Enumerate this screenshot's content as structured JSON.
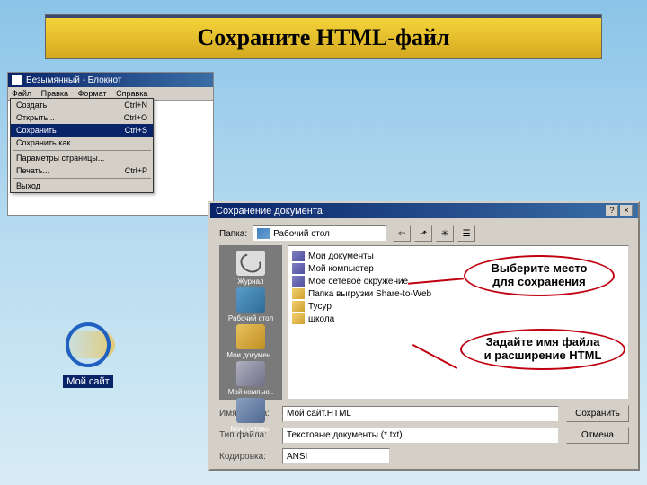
{
  "slide": {
    "title": "Сохраните HTML-файл"
  },
  "notepad": {
    "window_title": "Безымянный - Блокнот",
    "menu": {
      "file": "Файл",
      "edit": "Правка",
      "format": "Формат",
      "help": "Справка"
    },
    "items": [
      {
        "label": "Создать",
        "shortcut": "Ctrl+N"
      },
      {
        "label": "Открыть...",
        "shortcut": "Ctrl+O"
      },
      {
        "label": "Сохранить",
        "shortcut": "Ctrl+S",
        "selected": true
      },
      {
        "label": "Сохранить как...",
        "shortcut": ""
      },
      {
        "label": "Параметры страницы...",
        "shortcut": ""
      },
      {
        "label": "Печать...",
        "shortcut": "Ctrl+P"
      },
      {
        "label": "Выход",
        "shortcut": ""
      }
    ]
  },
  "ie": {
    "label": "Мой сайт"
  },
  "save_dialog": {
    "title": "Сохранение документа",
    "folder_label": "Папка:",
    "current_folder": "Рабочий стол",
    "sidebar": {
      "history": "Журнал",
      "desktop": "Рабочий стол",
      "mydocs": "Мои докумен..",
      "mycomp": "Мой компью..",
      "mynet": "Мое сетево."
    },
    "files": [
      "Мои документы",
      "Мой компьютер",
      "Мое сетевое окружение",
      "Папка выгрузки Share-to-Web",
      "Тусур",
      "школа"
    ],
    "filename_label": "Имя файла:",
    "filename_value": "Мой сайт.HTML",
    "type_label": "Тип файла:",
    "type_value": "Текстовые документы (*.txt)",
    "encoding_label": "Кодировка:",
    "encoding_value": "ANSI",
    "save_btn": "Сохранить",
    "cancel_btn": "Отмена"
  },
  "callouts": {
    "c1_l1": "Выберите место",
    "c1_l2": "для сохранения",
    "c2_l1": "Задайте имя файла",
    "c2_l2": "и расширение HTML"
  }
}
